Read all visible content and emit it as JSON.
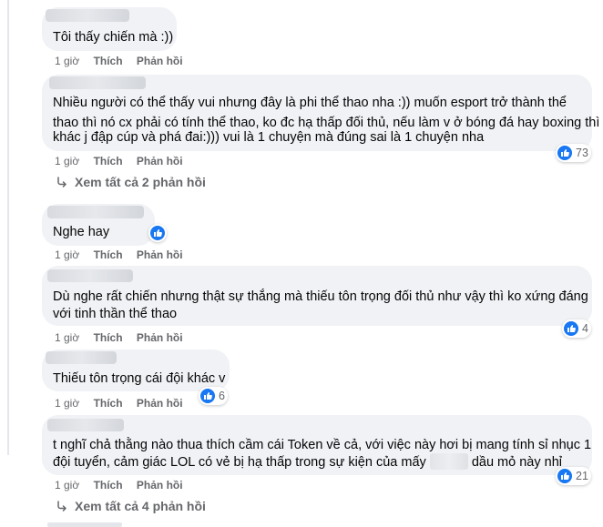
{
  "comments": [
    {
      "text": "Tôi thấy chiến mà :))",
      "time": "1 giờ",
      "like": "Thích",
      "reply": "Phản hồi"
    },
    {
      "lines": [
        "Nhiều người có thể thấy vui nhưng đây là phi thể thao nha :)) muốn esport trở thành thể",
        "thao thì nó cx phải có tính thể thao, ko đc hạ thấp đối thủ, nếu làm v ở bóng đá hay boxing thì",
        "khác j đập cúp và phá đai:))) vui là 1 chuyện mà đúng sai là 1 chuyện nha"
      ],
      "time": "1 giờ",
      "like": "Thích",
      "reply": "Phản hồi",
      "reactions": "73",
      "view_replies": "Xem tất cả 2 phản hồi"
    },
    {
      "text": "Nghe hay",
      "time": "1 giờ",
      "like": "Thích",
      "reply": "Phản hồi"
    },
    {
      "lines": [
        "Dù nghe rất chiến nhưng thật sự thắng mà thiếu tôn trọng đối thủ như vậy thì ko xứng đáng",
        "với tinh thần thể thao"
      ],
      "time": "1 giờ",
      "like": "Thích",
      "reply": "Phản hồi",
      "reactions": "4"
    },
    {
      "text": "Thiếu tôn trọng cái đội khác v",
      "time": "1 giờ",
      "like": "Thích",
      "reply": "Phản hồi",
      "reactions": "6"
    },
    {
      "line1": "t nghĩ chả thằng nào thua thích cầm cái Token về cả, với việc này hơi bị mang tính sỉ nhục 1",
      "line2_start": "đội tuyển, cảm giác LOL có vẻ bị hạ thấp trong sự kiện của mấy",
      "line2_end": "dầu mỏ này nhỉ",
      "time": "1 giờ",
      "like": "Thích",
      "reply": "Phản hồi",
      "reactions": "21",
      "view_replies": "Xem tất cả 4 phản hồi"
    }
  ],
  "colors": {
    "bubble": "#f0f2f5",
    "meta": "#65676b",
    "like_blue": "#1877f2"
  },
  "icons": {
    "reaction": "like-icon",
    "replies": "reply-arrow-icon"
  }
}
